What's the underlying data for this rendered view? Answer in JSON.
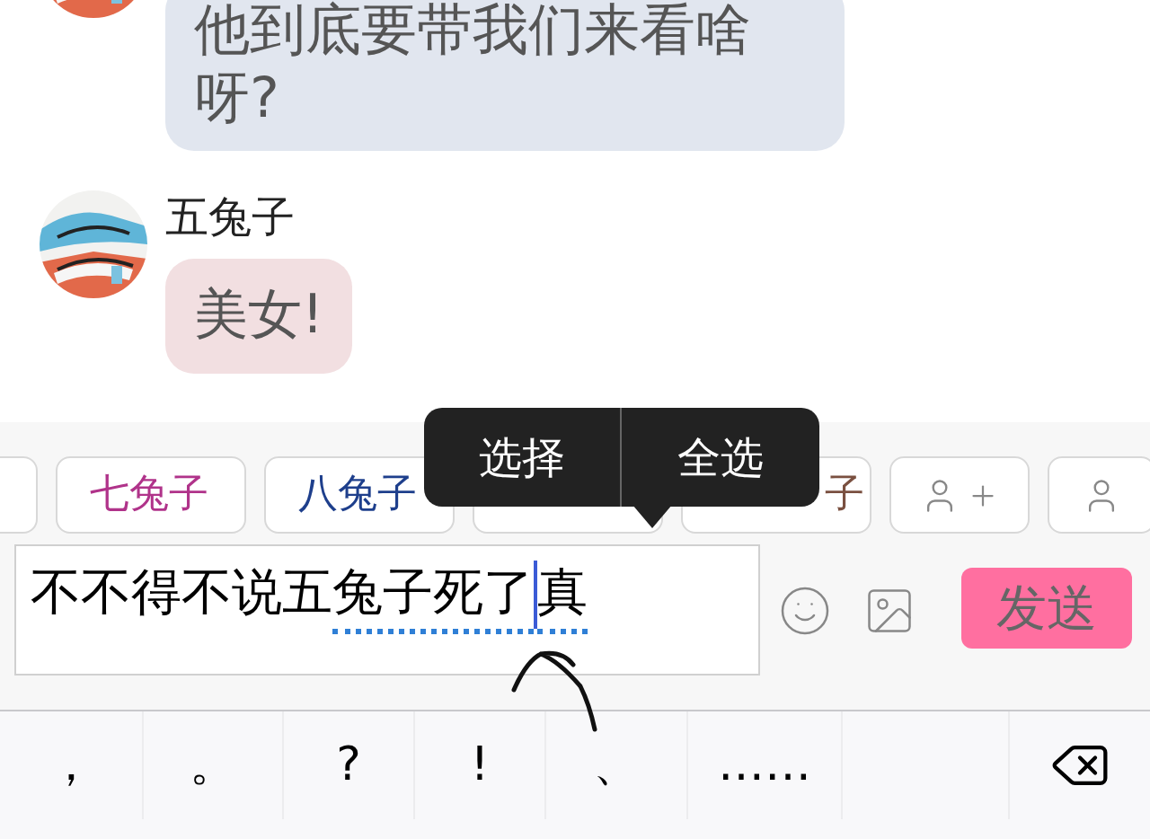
{
  "messages": [
    {
      "text": "他到底要带我们来看啥呀?",
      "color": "#e1e6ef"
    },
    {
      "sender": "五兔子",
      "text": "美女!",
      "color": "#f2dfe1"
    }
  ],
  "quick_replies": [
    {
      "kind": "covered"
    },
    {
      "kind": "label",
      "label": "七兔子",
      "color": "#b0338a"
    },
    {
      "kind": "label",
      "label": "八兔子",
      "color": "#1e3f8c"
    },
    {
      "kind": "covered"
    },
    {
      "kind": "label",
      "label": "子",
      "color": "#7a5040"
    }
  ],
  "context_menu": [
    "选择",
    "全选"
  ],
  "input": {
    "segments": [
      {
        "kind": "text",
        "text": "不不得不说五",
        "marked": false
      },
      {
        "kind": "text",
        "text": "兔子死了",
        "marked": true
      },
      {
        "kind": "cursor"
      },
      {
        "kind": "text",
        "text": "真",
        "marked": true
      }
    ]
  },
  "send_button": "发送",
  "keyboard_keys": [
    "，",
    "。",
    "?",
    "!",
    "、",
    "……"
  ]
}
